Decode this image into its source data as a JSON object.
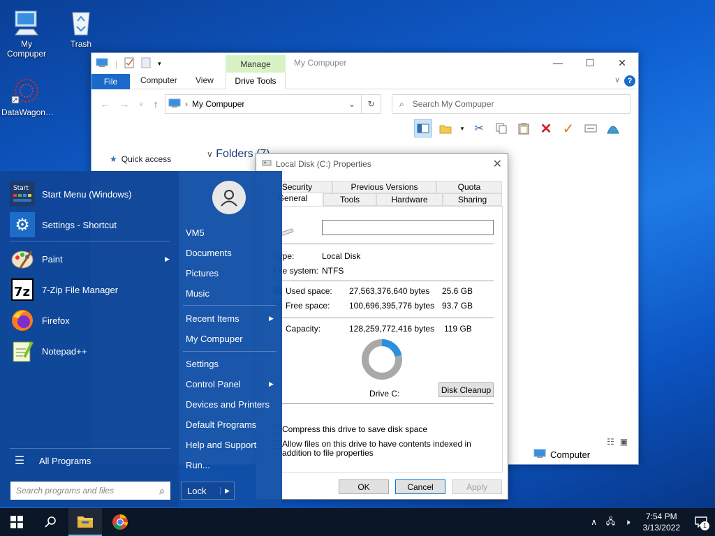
{
  "desktop": {
    "icons": [
      {
        "label": "My\nCompuper",
        "icon": "computer-icon"
      },
      {
        "label": "Trash",
        "icon": "recycle-bin-icon"
      },
      {
        "label": "DataWagon…",
        "icon": "datawagon-icon"
      }
    ]
  },
  "explorer": {
    "title": "My Compuper",
    "manage_tab": "Manage",
    "tabs": {
      "file": "File",
      "computer": "Computer",
      "view": "View",
      "drive_tools": "Drive Tools"
    },
    "address": "My Compuper",
    "search_placeholder": "Search My Compuper",
    "quick_access": "Quick access",
    "folders_header": "Folders (7)",
    "status_selected": "Computer"
  },
  "properties": {
    "title": "Local Disk (C:) Properties",
    "tabs_row1": [
      "Security",
      "Previous Versions",
      "Quota"
    ],
    "tabs_row2": [
      "General",
      "Tools",
      "Hardware",
      "Sharing"
    ],
    "type_label": "Type:",
    "type_value": "Local Disk",
    "fs_label": "File system:",
    "fs_value": "NTFS",
    "used_label": "Used space:",
    "used_bytes": "27,563,376,640 bytes",
    "used_gb": "25.6 GB",
    "free_label": "Free space:",
    "free_bytes": "100,696,395,776 bytes",
    "free_gb": "93.7 GB",
    "capacity_label": "Capacity:",
    "capacity_bytes": "128,259,772,416 bytes",
    "capacity_gb": "119 GB",
    "drive_label": "Drive C:",
    "used_fraction": 0.215,
    "disk_cleanup": "Disk Cleanup",
    "compress_text": "Compress this drive to save disk space",
    "index_text": "Allow files on this drive to have contents indexed in addition to file properties",
    "ok": "OK",
    "cancel": "Cancel",
    "apply": "Apply",
    "colors": {
      "used": "#2b8fdc",
      "free": "#a9a9a9"
    }
  },
  "start_menu": {
    "pinned": [
      {
        "label": "Start Menu (Windows)",
        "icon": "start-menu-icon"
      },
      {
        "label": "Settings - Shortcut",
        "icon": "gear-icon"
      },
      {
        "label": "Paint",
        "icon": "paint-icon"
      },
      {
        "label": "7-Zip File Manager",
        "icon": "7zip-icon"
      },
      {
        "label": "Firefox",
        "icon": "firefox-icon"
      },
      {
        "label": "Notepad++",
        "icon": "notepad-plus-plus-icon"
      }
    ],
    "all_programs": "All Programs",
    "search_placeholder": "Search programs and files",
    "right": {
      "user": "VM5",
      "documents": "Documents",
      "pictures": "Pictures",
      "music": "Music",
      "recent_items": "Recent Items",
      "my_computer": "My Compuper",
      "settings": "Settings",
      "control_panel": "Control Panel",
      "devices": "Devices and Printers",
      "default_programs": "Default Programs",
      "help": "Help and Support",
      "run": "Run..."
    },
    "lock": "Lock"
  },
  "taskbar": {
    "time": "7:54 PM",
    "date": "3/13/2022",
    "notification_count": "1"
  }
}
